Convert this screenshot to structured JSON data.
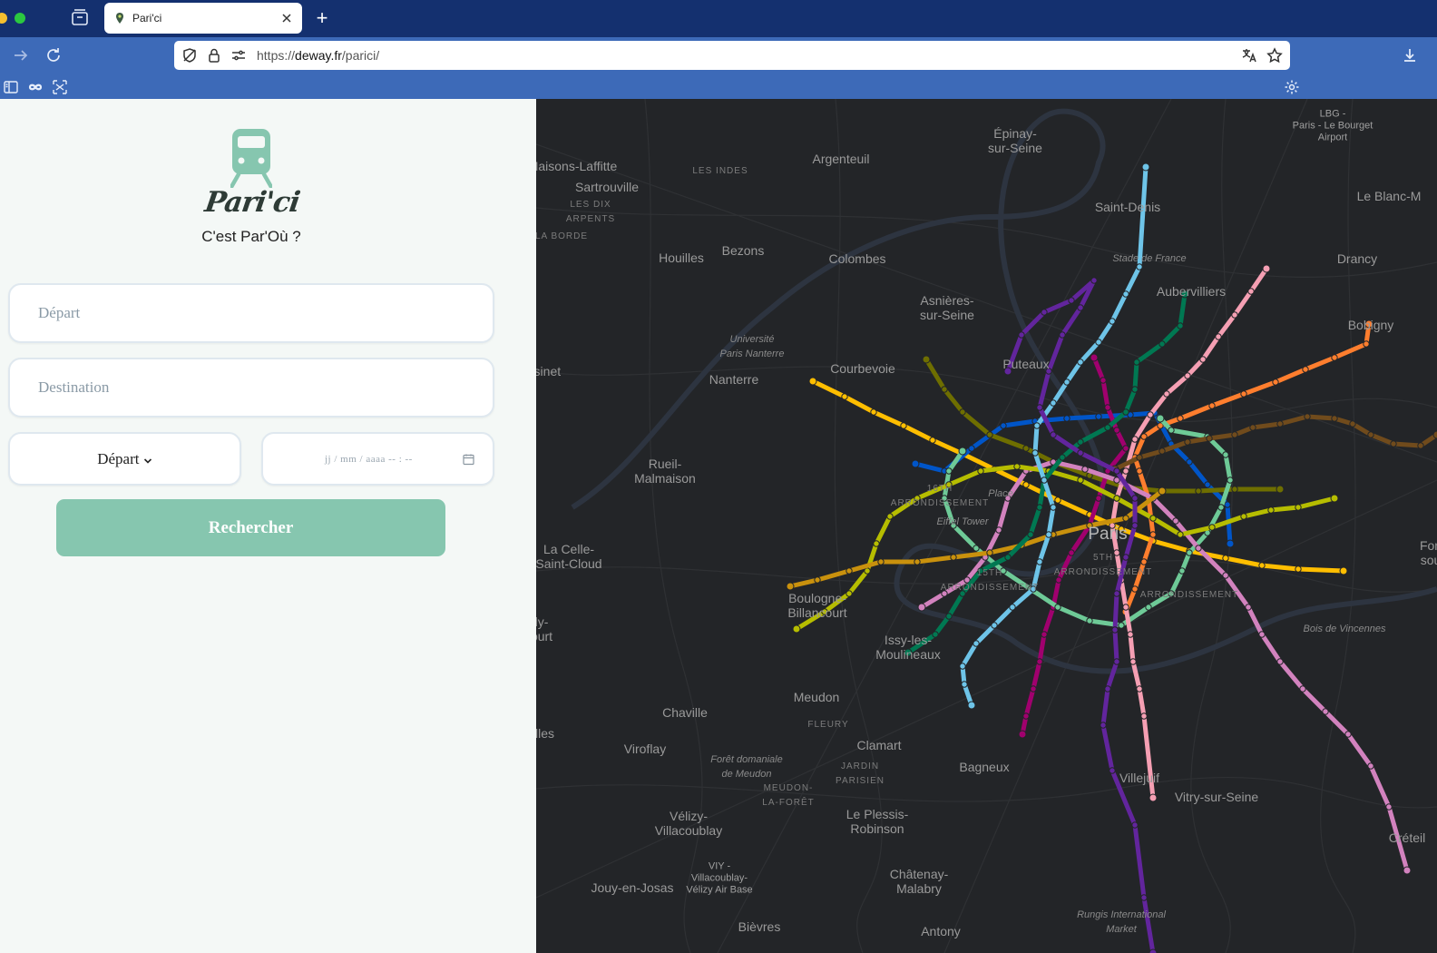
{
  "browser": {
    "tab_title": "Pari'ci",
    "url_prefix": "https://",
    "url_domain": "deway.fr",
    "url_path": "/parici/"
  },
  "app": {
    "brand": "Pari'ci",
    "tagline": "C'est Par'Où ?",
    "departure_placeholder": "Départ",
    "destination_placeholder": "Destination",
    "mode_selected": "Départ",
    "date_placeholder": "jj / mm / aaaa   -- : --",
    "search_button": "Rechercher"
  },
  "colors": {
    "accent": "#86c6af",
    "tab_bar": "#14306f",
    "nav_bar": "#3d6ab8",
    "map_bg": "#232528"
  },
  "map": {
    "labels": [
      {
        "text": "Épinay-\nsur-Seine",
        "style": "normal"
      },
      {
        "text": "LBG -\nParis - Le Bourget\nAirport",
        "style": "small-caps"
      },
      {
        "text": "Maisons-Laffitte",
        "style": "normal"
      },
      {
        "text": "Argenteuil",
        "style": "normal"
      },
      {
        "text": "LES INDES",
        "style": "small"
      },
      {
        "text": "Sartrouville",
        "style": "normal"
      },
      {
        "text": "LES DIX\nARPENTS",
        "style": "small"
      },
      {
        "text": "Saint-Denis",
        "style": "normal"
      },
      {
        "text": "Le Blanc-M",
        "style": "normal"
      },
      {
        "text": "LA BORDE",
        "style": "small"
      },
      {
        "text": "Houilles",
        "style": "normal"
      },
      {
        "text": "Bezons",
        "style": "normal"
      },
      {
        "text": "Colombes",
        "style": "normal"
      },
      {
        "text": "Stade de France",
        "style": "italic"
      },
      {
        "text": "Drancy",
        "style": "normal"
      },
      {
        "text": "Aubervilliers",
        "style": "normal"
      },
      {
        "text": "Asnières-\nsur-Seine",
        "style": "normal"
      },
      {
        "text": "Bobigny",
        "style": "normal"
      },
      {
        "text": "Université\nParis Nanterre",
        "style": "italic"
      },
      {
        "text": "Nanterre",
        "style": "normal"
      },
      {
        "text": "Courbevoie",
        "style": "normal"
      },
      {
        "text": "Puteaux",
        "style": "normal"
      },
      {
        "text": "Rueil-\nMalmaison",
        "style": "normal"
      },
      {
        "text": "16TH\nARRONDISSEMENT",
        "style": "small"
      },
      {
        "text": "Eiffel Tower",
        "style": "italic"
      },
      {
        "text": "Place",
        "style": "italic"
      },
      {
        "text": "Paris",
        "style": "big"
      },
      {
        "text": "La Celle-\nSaint-Cloud",
        "style": "normal"
      },
      {
        "text": "Boulogne-\nBillancourt",
        "style": "normal"
      },
      {
        "text": "15TH\nARRONDISSEMENT",
        "style": "small"
      },
      {
        "text": "5TH\nARRONDISSEMENT",
        "style": "small"
      },
      {
        "text": "ARRONDISSEMENT",
        "style": "small"
      },
      {
        "text": "Bois de Vincennes",
        "style": "italic"
      },
      {
        "text": "Issy-les-\nMoulineaux",
        "style": "normal"
      },
      {
        "text": "Meudon",
        "style": "normal"
      },
      {
        "text": "FLEURY",
        "style": "small"
      },
      {
        "text": "Chaville",
        "style": "normal"
      },
      {
        "text": "Viroflay",
        "style": "normal"
      },
      {
        "text": "Forêt domaniale\nde Meudon",
        "style": "italic"
      },
      {
        "text": "Clamart",
        "style": "normal"
      },
      {
        "text": "JARDIN\nPARISIEN",
        "style": "small"
      },
      {
        "text": "Bagneux",
        "style": "normal"
      },
      {
        "text": "MEUDON-\nLA-FORÊT",
        "style": "small"
      },
      {
        "text": "Villejuif",
        "style": "normal"
      },
      {
        "text": "Vitry-sur-Seine",
        "style": "normal"
      },
      {
        "text": "Vélizy-\nVillacoublay",
        "style": "normal"
      },
      {
        "text": "Le Plessis-\nRobinson",
        "style": "normal"
      },
      {
        "text": "Créteil",
        "style": "normal"
      },
      {
        "text": "VIY -\nVillacoublay-\nVélizy Air Base",
        "style": "small-caps"
      },
      {
        "text": "Jouy-en-Josas",
        "style": "normal"
      },
      {
        "text": "Châtenay-\nMalabry",
        "style": "normal"
      },
      {
        "text": "Bièvres",
        "style": "normal"
      },
      {
        "text": "Antony",
        "style": "normal"
      },
      {
        "text": "Rungis International\nMarket",
        "style": "italic"
      },
      {
        "text": "Fon\nsou",
        "style": "normal"
      },
      {
        "text": "-sinet",
        "style": "normal"
      },
      {
        "text": "ly-\nourt",
        "style": "normal"
      },
      {
        "text": "illes",
        "style": "normal"
      }
    ],
    "lines": [
      {
        "name": "1",
        "color": "#ffbe00"
      },
      {
        "name": "2",
        "color": "#0055c8"
      },
      {
        "name": "3",
        "color": "#6e6e00"
      },
      {
        "name": "4",
        "color": "#a0006e"
      },
      {
        "name": "5",
        "color": "#ff7e2e"
      },
      {
        "name": "6",
        "color": "#6eca97"
      },
      {
        "name": "7",
        "color": "#f59fb3"
      },
      {
        "name": "8",
        "color": "#d282be"
      },
      {
        "name": "9",
        "color": "#b6bd00"
      },
      {
        "name": "10",
        "color": "#c9910d"
      },
      {
        "name": "11",
        "color": "#704b1c"
      },
      {
        "name": "12",
        "color": "#007852"
      },
      {
        "name": "13",
        "color": "#6ec4e8"
      },
      {
        "name": "14",
        "color": "#62259d"
      }
    ]
  }
}
